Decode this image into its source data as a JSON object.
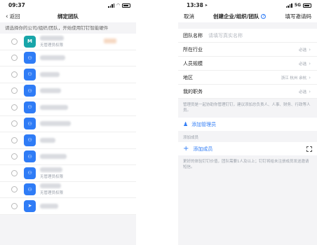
{
  "left": {
    "status": {
      "time": "09:37"
    },
    "nav": {
      "back_label": "返回",
      "title": "绑定团队"
    },
    "hint": "请选择你的公司/组织/团队，开始使用钉钉智能硬件",
    "orgs": [
      {
        "sub": "无管理员权限"
      },
      {
        "sub": ""
      },
      {
        "sub": ""
      },
      {
        "sub": ""
      },
      {
        "sub": ""
      },
      {
        "sub": ""
      },
      {
        "sub": ""
      },
      {
        "sub": ""
      },
      {
        "sub": "无管理员权限"
      },
      {
        "sub": "无管理员权限"
      },
      {
        "sub": ""
      }
    ]
  },
  "right": {
    "status": {
      "time": "13:38",
      "network": "5G"
    },
    "nav": {
      "cancel_label": "取消",
      "title": "创建企业/组织/团队",
      "invite_label": "填写邀请码"
    },
    "fields": {
      "team_name_label": "团队名称",
      "team_name_placeholder": "请填写真实名称",
      "industry_label": "所在行业",
      "industry_value": "必选",
      "size_label": "人员规模",
      "size_value": "必选",
      "region_label": "地区",
      "region_value": "浙江 杭州 余杭",
      "role_label": "我的职务",
      "role_value": "必选"
    },
    "admin_desc": "管理员是一起协助你管理钉钉，建议添加总负责人、人事、财务、行政等人员。",
    "add_admin_label": "添加管理员",
    "members_section": "添加成员",
    "add_member_label": "添加成员",
    "footnote": "更好的体验钉钉价值，团队需要1人及以上；钉钉将给未注册成员发送邀请短信。"
  }
}
